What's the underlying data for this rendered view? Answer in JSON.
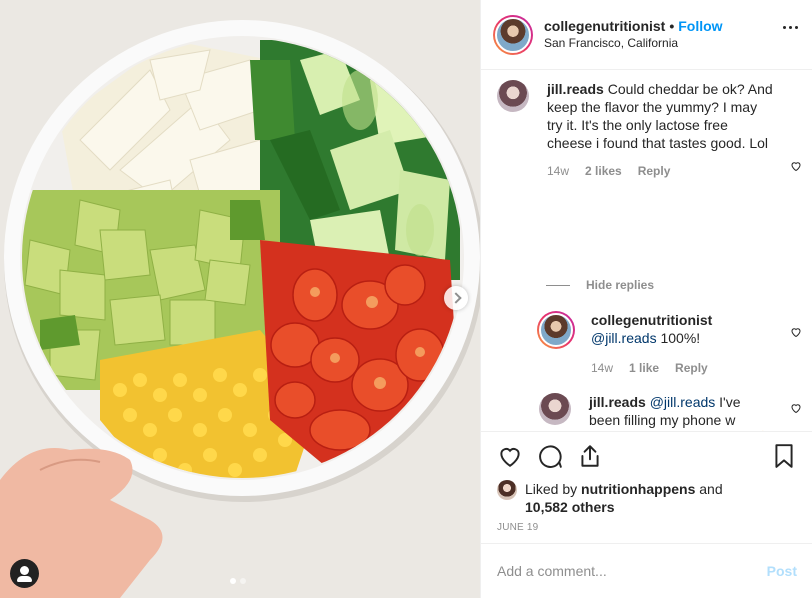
{
  "photo": {
    "carousel_index": 1,
    "carousel_count": 2,
    "next_icon": "chevron-right-icon",
    "tag_icon": "user-tag-icon"
  },
  "header": {
    "username": "collegenutritionist",
    "separator": "•",
    "follow_label": "Follow",
    "location": "San Francisco, California",
    "more_icon": "more-options-icon"
  },
  "comments": [
    {
      "username": "jill.reads",
      "text": "Could cheddar be ok? And keep the flavor the yummy? I may try it. It's the only lactose free cheese i found that tastes good. Lol",
      "time": "14w",
      "likes": "2 likes",
      "reply_label": "Reply",
      "hide_replies_label": "Hide replies"
    },
    {
      "username": "collegenutritionist",
      "mention": "@jill.reads",
      "text": "100%!",
      "time": "14w",
      "likes": "1 like",
      "reply_label": "Reply"
    },
    {
      "username": "jill.reads",
      "mention": "@jill.reads",
      "text": "I've been filling my phone w screen shots of your food. 😂 so motivating!! I've been struggling to come up w healthy ideas for work"
    }
  ],
  "actions": {
    "icons": [
      "heart-icon",
      "comment-icon",
      "share-icon",
      "bookmark-icon"
    ],
    "liked_prefix": "Liked by",
    "liked_user": "nutritionhappens",
    "liked_and": "and",
    "liked_others": "10,582 others",
    "date": "JUNE 19"
  },
  "add_comment": {
    "placeholder": "Add a comment...",
    "post_label": "Post"
  },
  "colors": {
    "link_blue": "#0095f6",
    "mention_blue": "#00376b",
    "muted": "#8e8e8e",
    "post_disabled": "#b2dffc"
  }
}
